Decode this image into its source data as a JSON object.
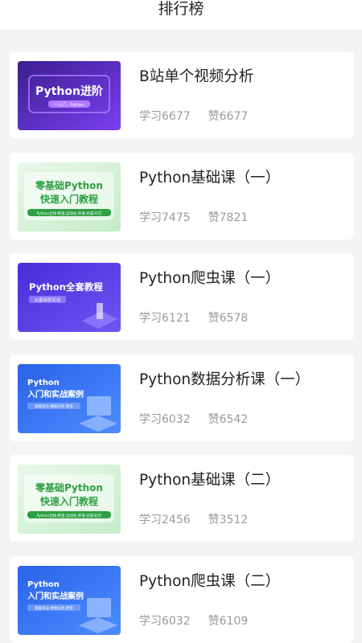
{
  "header": {
    "title": "排行榜"
  },
  "courses": [
    {
      "title": "B站单个视频分析",
      "study_label": "学习6677",
      "like_label": "赞6677",
      "thumb": {
        "style": "purple",
        "line1": "Python进阶",
        "line2": "",
        "sub": "一入门 · Python",
        "bg1": "#3b1f8f",
        "bg2": "#7a3ff0",
        "accent": "#b27cff"
      }
    },
    {
      "title": "Python基础课（一）",
      "study_label": "学习7475",
      "like_label": "赞7821",
      "thumb": {
        "style": "green",
        "line1": "零基础Python",
        "line2": "快速入门教程",
        "sub": "Python全栈·爬虫·自动化·开发·达成30万",
        "bg1": "#e9f8ea",
        "bg2": "#c5ecc8",
        "accent": "#2ea043"
      }
    },
    {
      "title": "Python爬虫课（一）",
      "study_label": "学习6121",
      "like_label": "赞6578",
      "thumb": {
        "style": "violet",
        "line1": "Python全套教程",
        "line2": "",
        "sub": "从基础到实战",
        "bg1": "#4a2bd9",
        "bg2": "#6f55f2",
        "accent": "#9e8cff"
      }
    },
    {
      "title": "Python数据分析课（一）",
      "study_label": "学习6032",
      "like_label": "赞6542",
      "thumb": {
        "style": "blue",
        "line1": "Python",
        "line2": "入门和实战案例",
        "sub": "基础语法·数据分析·爬虫",
        "bg1": "#2a63e8",
        "bg2": "#4d8cff",
        "accent": "#9cc2ff"
      }
    },
    {
      "title": "Python基础课（二）",
      "study_label": "学习2456",
      "like_label": "赞3512",
      "thumb": {
        "style": "green",
        "line1": "零基础Python",
        "line2": "快速入门教程",
        "sub": "Python全栈·爬虫·自动化·开发·达成30万",
        "bg1": "#e9f8ea",
        "bg2": "#c5ecc8",
        "accent": "#2ea043"
      }
    },
    {
      "title": "Python爬虫课（二）",
      "study_label": "学习6032",
      "like_label": "赞6109",
      "thumb": {
        "style": "blue",
        "line1": "Python",
        "line2": "入门和实战案例",
        "sub": "基础语法·数据分析·爬虫",
        "bg1": "#2a63e8",
        "bg2": "#4d8cff",
        "accent": "#9cc2ff"
      }
    }
  ]
}
